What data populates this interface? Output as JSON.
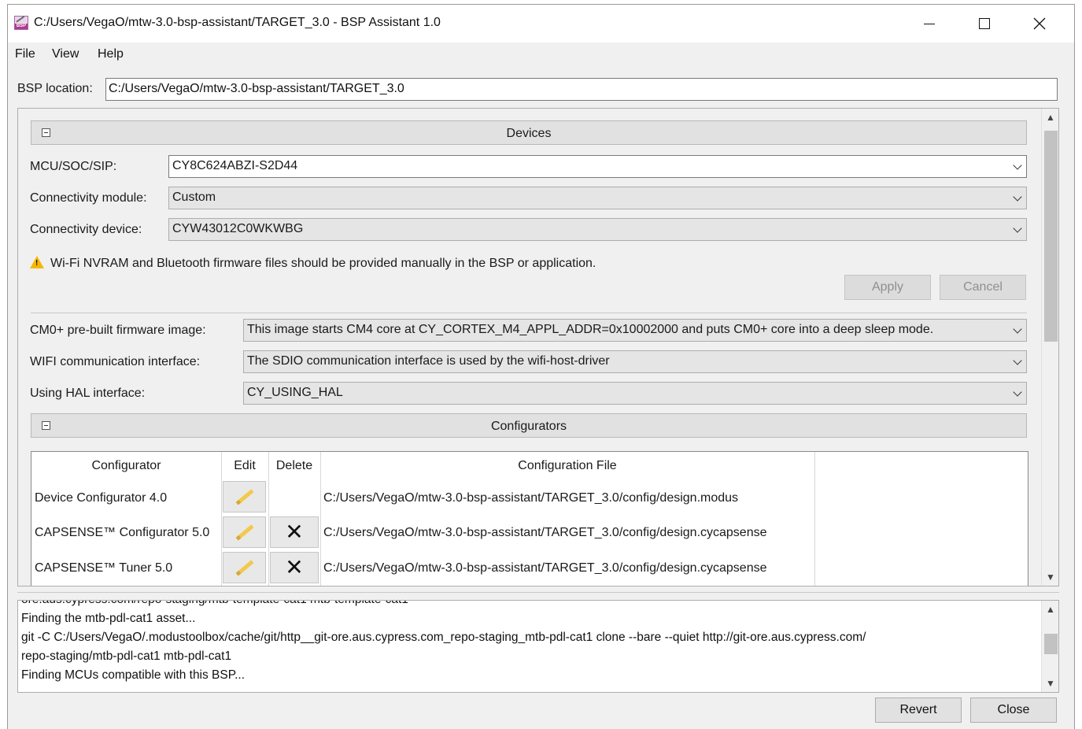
{
  "window": {
    "title": "C:/Users/VegaO/mtw-3.0-bsp-assistant/TARGET_3.0 - BSP Assistant 1.0",
    "icon_label": "BSP"
  },
  "menu": {
    "items": [
      "File",
      "View",
      "Help"
    ]
  },
  "bsp": {
    "label": "BSP location:",
    "value": "C:/Users/VegaO/mtw-3.0-bsp-assistant/TARGET_3.0"
  },
  "devices": {
    "title": "Devices",
    "mcu": {
      "label": "MCU/SOC/SIP:",
      "value": "CY8C624ABZI-S2D44"
    },
    "conn_module": {
      "label": "Connectivity module:",
      "value": "Custom"
    },
    "conn_device": {
      "label": "Connectivity device:",
      "value": "CYW43012C0WKWBG"
    },
    "warning": "Wi-Fi NVRAM and Bluetooth firmware files should be provided manually in the BSP or application.",
    "apply": "Apply",
    "cancel": "Cancel"
  },
  "options": {
    "cm0": {
      "label": "CM0+ pre-built firmware image:",
      "value": "This image starts CM4 core at CY_CORTEX_M4_APPL_ADDR=0x10002000 and puts CM0+ core into a deep sleep mode."
    },
    "wifi": {
      "label": "WIFI communication interface:",
      "value": "The SDIO communication interface is used by the wifi-host-driver"
    },
    "hal": {
      "label": "Using HAL interface:",
      "value": "CY_USING_HAL"
    }
  },
  "configurators": {
    "title": "Configurators",
    "headers": {
      "configurator": "Configurator",
      "edit": "Edit",
      "delete": "Delete",
      "file": "Configuration File"
    },
    "rows": [
      {
        "name": "Device Configurator 4.0",
        "file": "C:/Users/VegaO/mtw-3.0-bsp-assistant/TARGET_3.0/config/design.modus"
      },
      {
        "name": "CAPSENSE™ Configurator 5.0",
        "file": "C:/Users/VegaO/mtw-3.0-bsp-assistant/TARGET_3.0/config/design.cycapsense"
      },
      {
        "name": "CAPSENSE™ Tuner 5.0",
        "file": "C:/Users/VegaO/mtw-3.0-bsp-assistant/TARGET_3.0/config/design.cycapsense"
      }
    ]
  },
  "log": {
    "lines": [
      "ore.aus.cypress.com/repo-staging/mtb-template-cat1 mtb-template-cat1",
      "Finding the mtb-pdl-cat1 asset...",
      "git -C C:/Users/VegaO/.modustoolbox/cache/git/http__git-ore.aus.cypress.com_repo-staging_mtb-pdl-cat1 clone --bare --quiet http://git-ore.aus.cypress.com/",
      "repo-staging/mtb-pdl-cat1 mtb-pdl-cat1",
      "Finding MCUs compatible with this BSP..."
    ]
  },
  "footer": {
    "revert": "Revert",
    "close": "Close"
  }
}
